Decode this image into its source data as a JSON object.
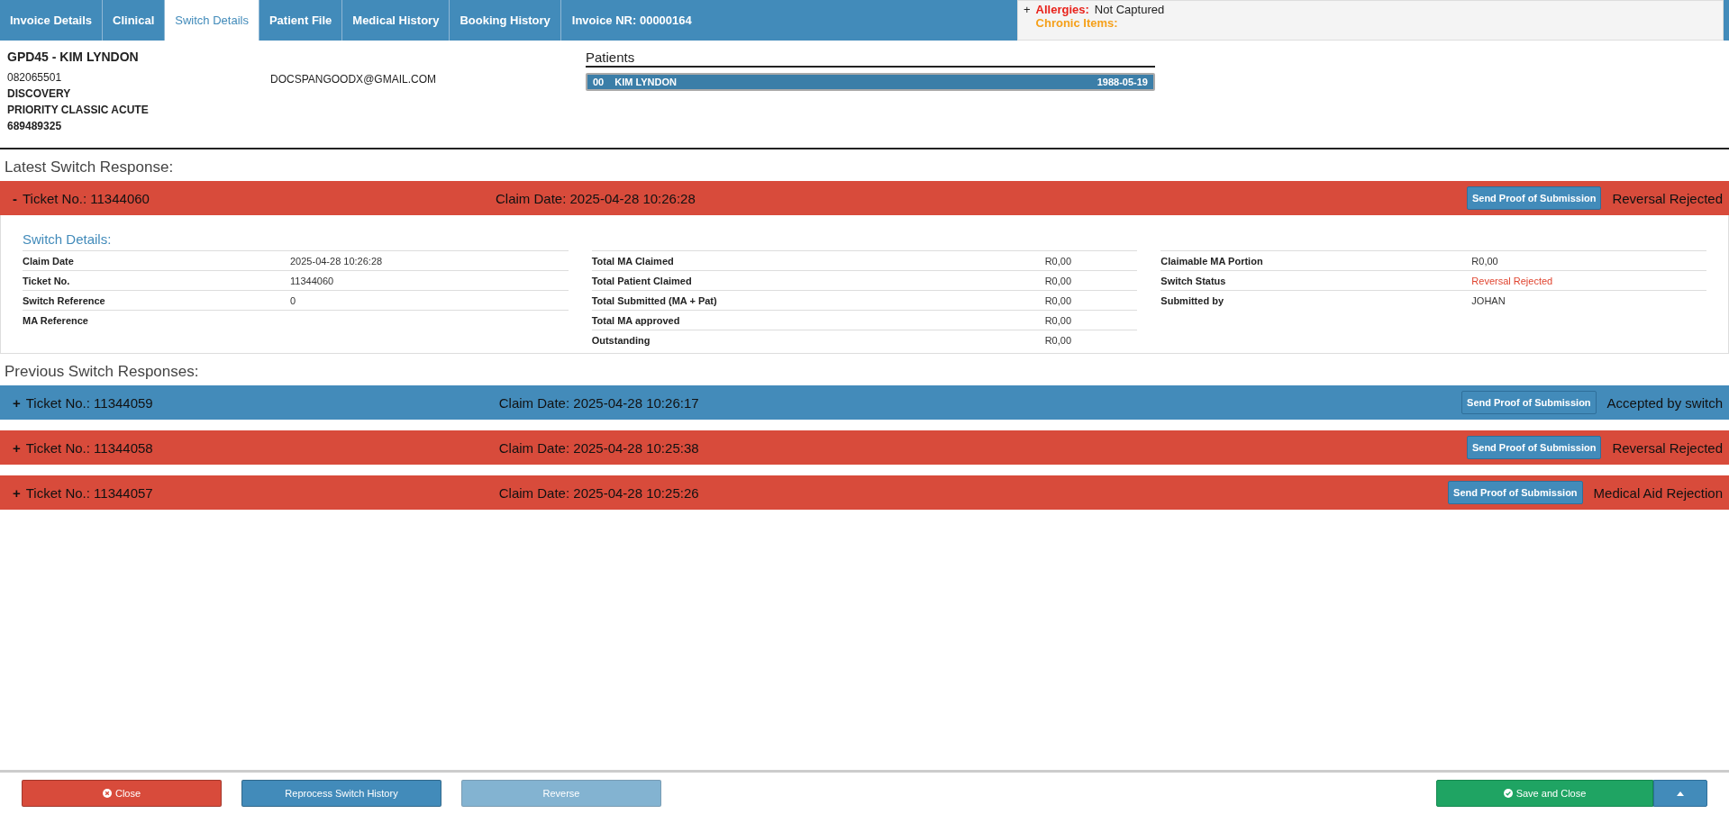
{
  "tabs": [
    {
      "label": "Invoice Details",
      "selected": false
    },
    {
      "label": "Clinical",
      "selected": false
    },
    {
      "label": "Switch Details",
      "selected": true
    },
    {
      "label": "Patient File",
      "selected": false
    },
    {
      "label": "Medical History",
      "selected": false
    },
    {
      "label": "Booking History",
      "selected": false
    }
  ],
  "invoice_nr": "Invoice NR: 00000164",
  "alerts": {
    "expander": "+",
    "allergies_label": "Allergies:",
    "allergies_value": "Not Captured",
    "chronic_label": "Chronic Items:"
  },
  "patient_header": {
    "title": "GPD45 - KIM LYNDON",
    "phone": "082065501",
    "email": "DOCSPANGOODX@GMAIL.COM",
    "lines": [
      "DISCOVERY",
      "PRIORITY CLASSIC ACUTE",
      "689489325"
    ]
  },
  "patients": {
    "title": "Patients",
    "rows": [
      {
        "code": "00",
        "name": "KIM LYNDON",
        "dob": "1988-05-19",
        "selected": true
      }
    ]
  },
  "latest_title": "Latest Switch Response:",
  "latest": [
    {
      "sign": "-",
      "ticket": "Ticket No.: 11344060",
      "claim_date": "Claim Date: 2025-04-28 10:26:28",
      "button": "Send Proof of Submission",
      "status": "Reversal Rejected",
      "color": "#d84b3b",
      "details": {
        "title": "Switch Details:",
        "columns": [
          [
            {
              "label": "Claim Date",
              "value": "2025-04-28 10:26:28"
            },
            {
              "label": "Ticket No.",
              "value": "11344060"
            },
            {
              "label": "Switch Reference",
              "value": "0"
            },
            {
              "label": "MA Reference"
            }
          ],
          [
            {
              "label": "Total MA Claimed",
              "value": "R0,00"
            },
            {
              "label": "Total Patient Claimed",
              "value": "R0,00"
            },
            {
              "label": "Total Submitted (MA + Pat)",
              "value": "R0,00"
            },
            {
              "label": "Total MA approved",
              "value": "R0,00"
            },
            {
              "label": "Outstanding",
              "value": "R0,00"
            }
          ],
          [
            {
              "label": "Claimable MA Portion",
              "value": "R0,00"
            },
            {
              "label": "Switch Status",
              "value": "Reversal Rejected",
              "alert": true
            },
            {
              "label": "Submitted by",
              "value": "JOHAN"
            }
          ]
        ]
      }
    }
  ],
  "previous_title": "Previous Switch Responses:",
  "previous": [
    {
      "sign": "+",
      "ticket": "Ticket No.: 11344059",
      "claim_date": "Claim Date: 2025-04-28 10:26:17",
      "button": "Send Proof of Submission",
      "status": "Accepted by switch",
      "color": "#438bba"
    },
    {
      "sign": "+",
      "ticket": "Ticket No.: 11344058",
      "claim_date": "Claim Date: 2025-04-28 10:25:38",
      "button": "Send Proof of Submission",
      "status": "Reversal Rejected",
      "color": "#d84b3b"
    },
    {
      "sign": "+",
      "ticket": "Ticket No.: 11344057",
      "claim_date": "Claim Date: 2025-04-28 10:25:26",
      "button": "Send Proof of Submission",
      "status": "Medical Aid Rejection",
      "color": "#d84b3b"
    }
  ],
  "footer": {
    "buttons": [
      {
        "label": "Close",
        "kind": "danger",
        "disabled": false
      },
      {
        "label": "Reprocess Switch History",
        "kind": "primary",
        "disabled": false
      },
      {
        "label": "Reverse",
        "kind": "primary",
        "disabled": true
      }
    ],
    "save": {
      "label": "Save and Close"
    }
  }
}
